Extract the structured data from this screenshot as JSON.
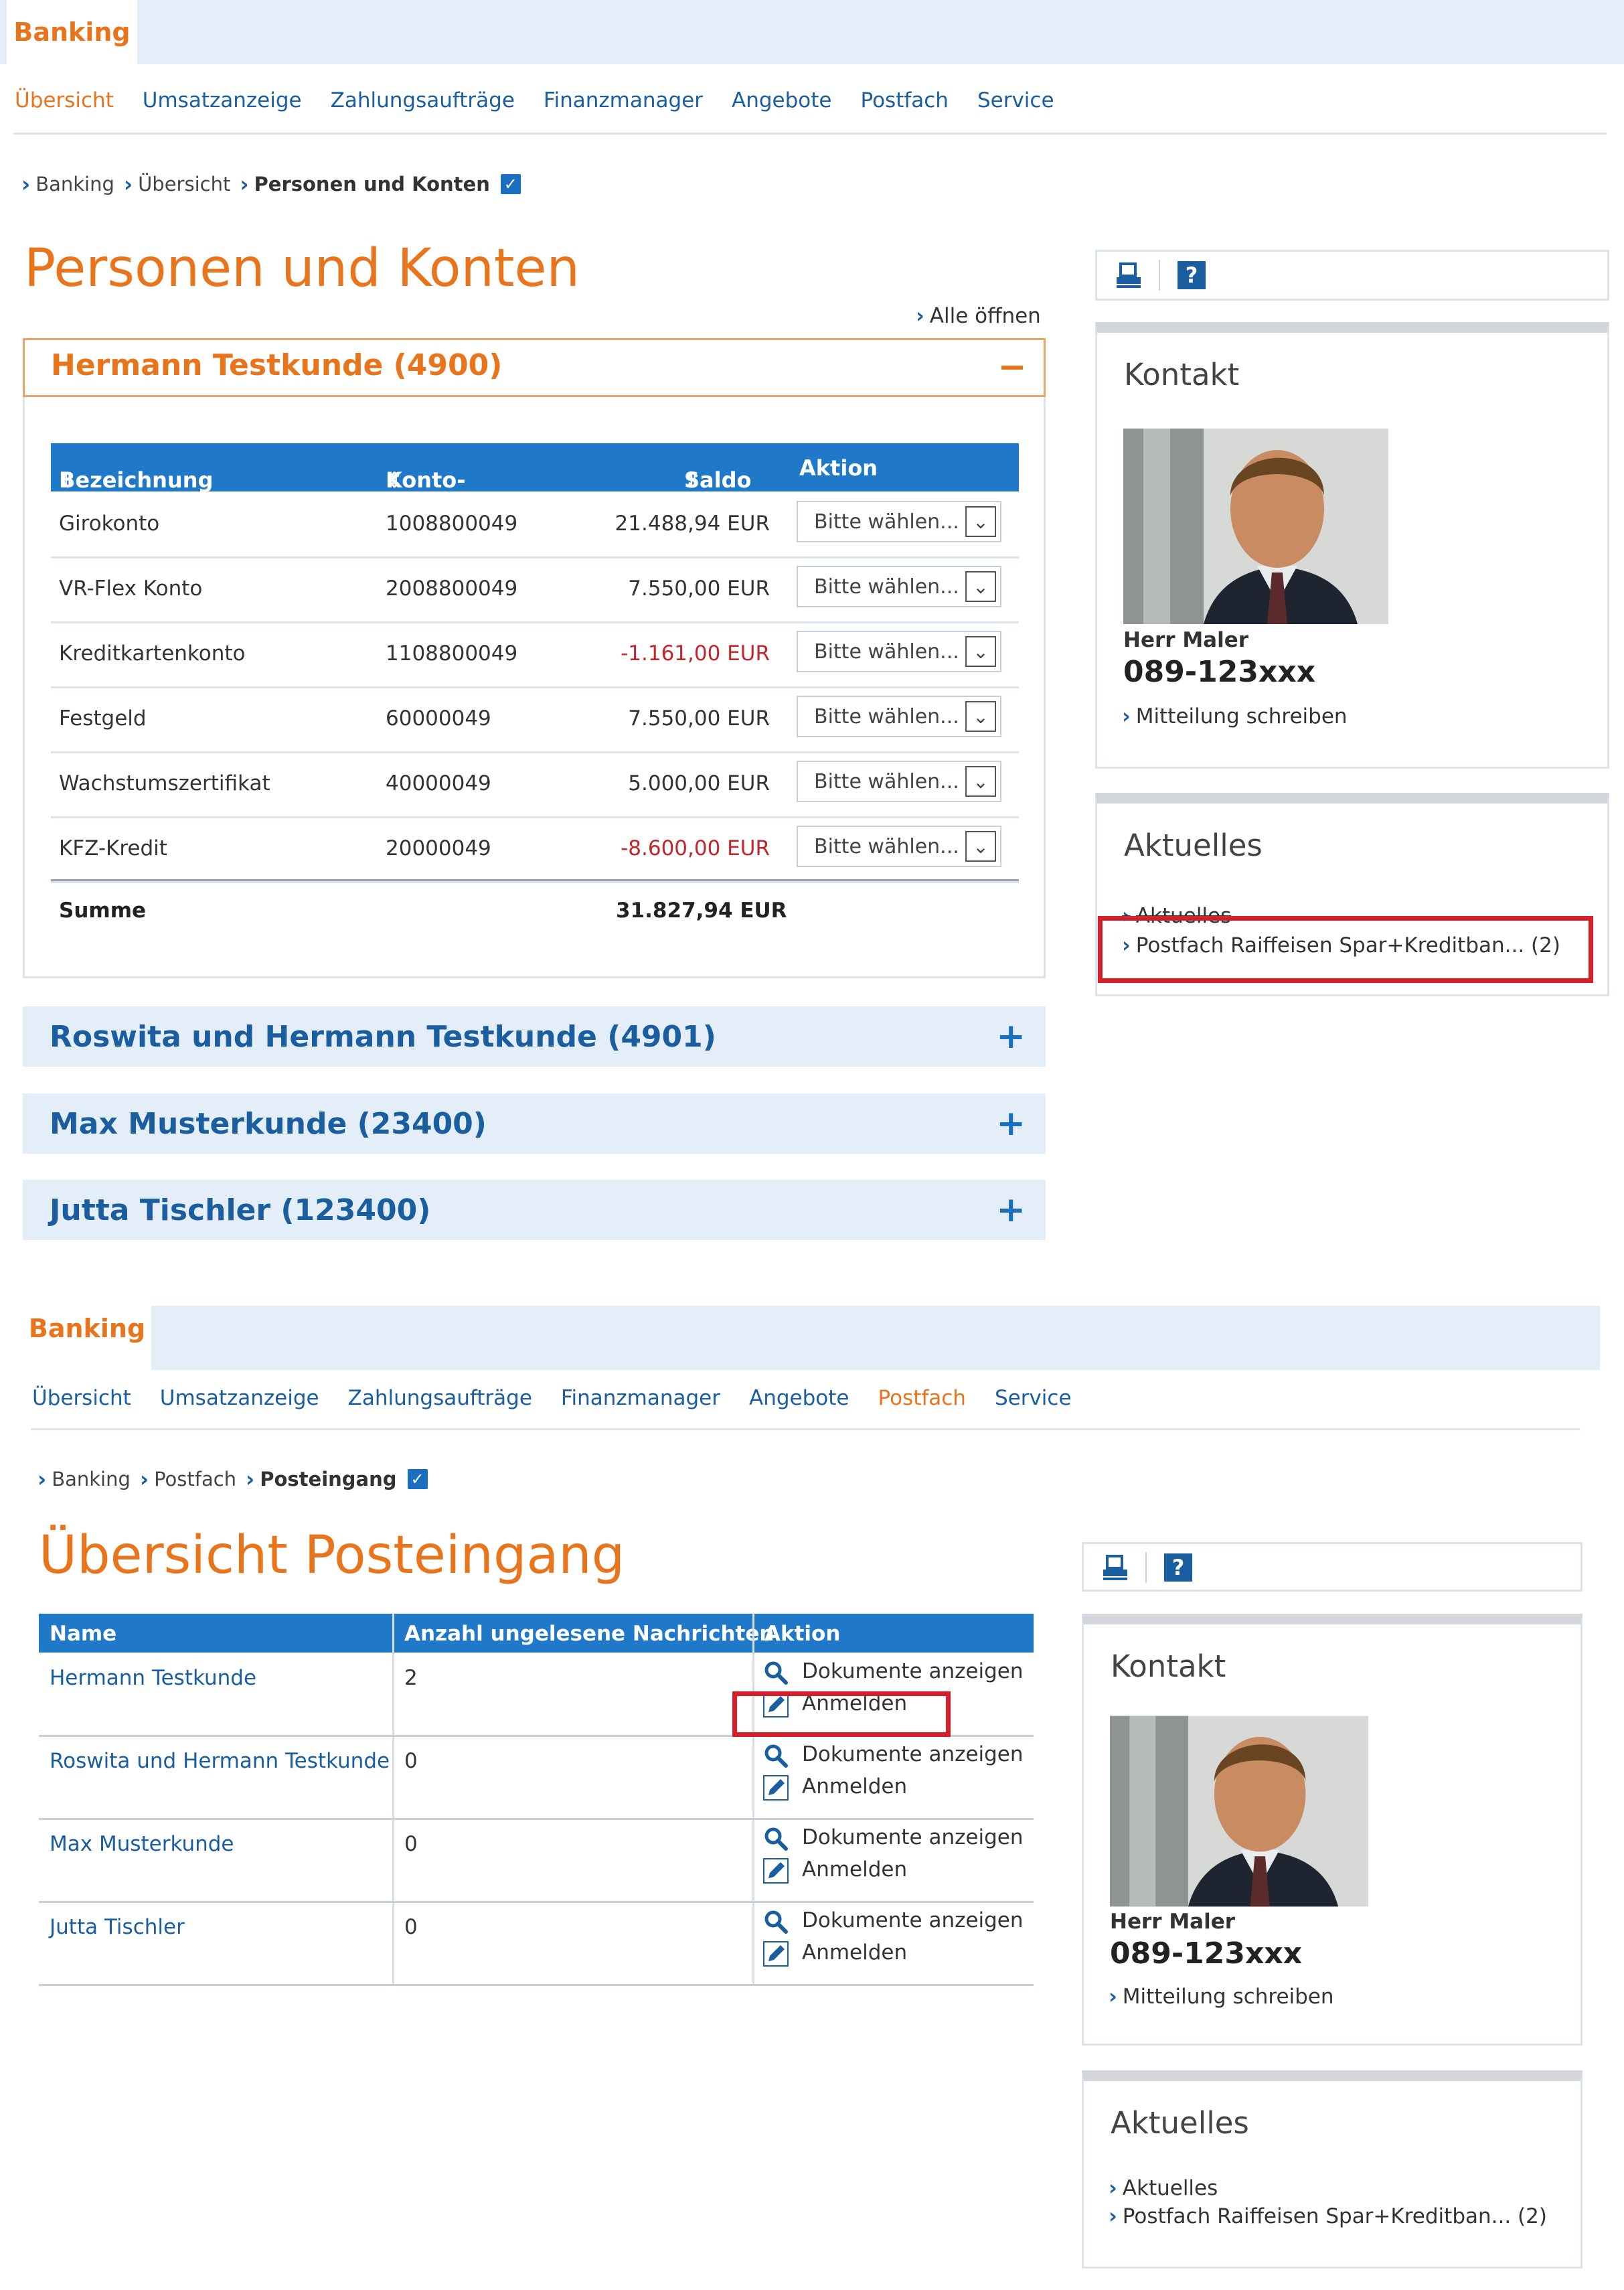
{
  "screen1": {
    "tab_label": "Banking",
    "nav": [
      "Übersicht",
      "Umsatzanzeige",
      "Zahlungsaufträge",
      "Finanzmanager",
      "Angebote",
      "Postfach",
      "Service"
    ],
    "nav_active": "Übersicht",
    "breadcrumb": [
      "Banking",
      "Übersicht"
    ],
    "breadcrumb_current": "Personen und Konten",
    "page_title": "Personen und Konten",
    "open_all": "Alle öffnen",
    "open_section": {
      "title": "Hermann Testkunde (4900)",
      "columns": [
        "Bezeichnung",
        "Konto-Nr.",
        "Saldo",
        "Aktion"
      ],
      "rows": [
        {
          "name": "Girokonto",
          "number": "1008800049",
          "balance": "21.488,94 EUR",
          "negative": false,
          "action": "Bitte wählen..."
        },
        {
          "name": "VR-Flex Konto",
          "number": "2008800049",
          "balance": "7.550,00 EUR",
          "negative": false,
          "action": "Bitte wählen..."
        },
        {
          "name": "Kreditkartenkonto",
          "number": "1108800049",
          "balance": "-1.161,00 EUR",
          "negative": true,
          "action": "Bitte wählen..."
        },
        {
          "name": "Festgeld",
          "number": "60000049",
          "balance": "7.550,00 EUR",
          "negative": false,
          "action": "Bitte wählen..."
        },
        {
          "name": "Wachstumszertifikat",
          "number": "40000049",
          "balance": "5.000,00 EUR",
          "negative": false,
          "action": "Bitte wählen..."
        },
        {
          "name": "KFZ-Kredit",
          "number": "20000049",
          "balance": "-8.600,00 EUR",
          "negative": true,
          "action": "Bitte wählen..."
        }
      ],
      "sum_label": "Summe",
      "sum_value": "31.827,94 EUR"
    },
    "closed_sections": [
      "Roswita und Hermann Testkunde (4901)",
      "Max Musterkunde (23400)",
      "Jutta Tischler (123400)"
    ],
    "contact": {
      "heading": "Kontakt",
      "name": "Herr Maler",
      "phone": "089-123xxx",
      "link": "Mitteilung schreiben"
    },
    "news": {
      "heading": "Aktuelles",
      "items": [
        "Aktuelles",
        "Postfach Raiffeisen Spar+Kreditban... (2)"
      ]
    }
  },
  "screen2": {
    "tab_label": "Banking",
    "nav": [
      "Übersicht",
      "Umsatzanzeige",
      "Zahlungsaufträge",
      "Finanzmanager",
      "Angebote",
      "Postfach",
      "Service"
    ],
    "nav_active": "Postfach",
    "breadcrumb": [
      "Banking",
      "Postfach"
    ],
    "breadcrumb_current": "Posteingang",
    "page_title": "Übersicht Posteingang",
    "columns": [
      "Name",
      "Anzahl ungelesene Nachrichten",
      "Aktion"
    ],
    "rows": [
      {
        "name": "Hermann Testkunde",
        "count": "2",
        "action1": "Dokumente anzeigen",
        "action2": "Anmelden"
      },
      {
        "name": "Roswita und Hermann Testkunde",
        "count": "0",
        "action1": "Dokumente anzeigen",
        "action2": "Anmelden"
      },
      {
        "name": "Max Musterkunde",
        "count": "0",
        "action1": "Dokumente anzeigen",
        "action2": "Anmelden"
      },
      {
        "name": "Jutta Tischler",
        "count": "0",
        "action1": "Dokumente anzeigen",
        "action2": "Anmelden"
      }
    ],
    "contact": {
      "heading": "Kontakt",
      "name": "Herr Maler",
      "phone": "089-123xxx",
      "link": "Mitteilung schreiben"
    },
    "news": {
      "heading": "Aktuelles",
      "items": [
        "Aktuelles",
        "Postfach Raiffeisen Spar+Kreditban... (2)"
      ]
    }
  },
  "colors": {
    "accent_orange": "#e8741c",
    "link_blue": "#1a5ea0",
    "table_header_blue": "#1f78c8",
    "negative_red": "#c0262d",
    "highlight_red": "#d4202a"
  }
}
